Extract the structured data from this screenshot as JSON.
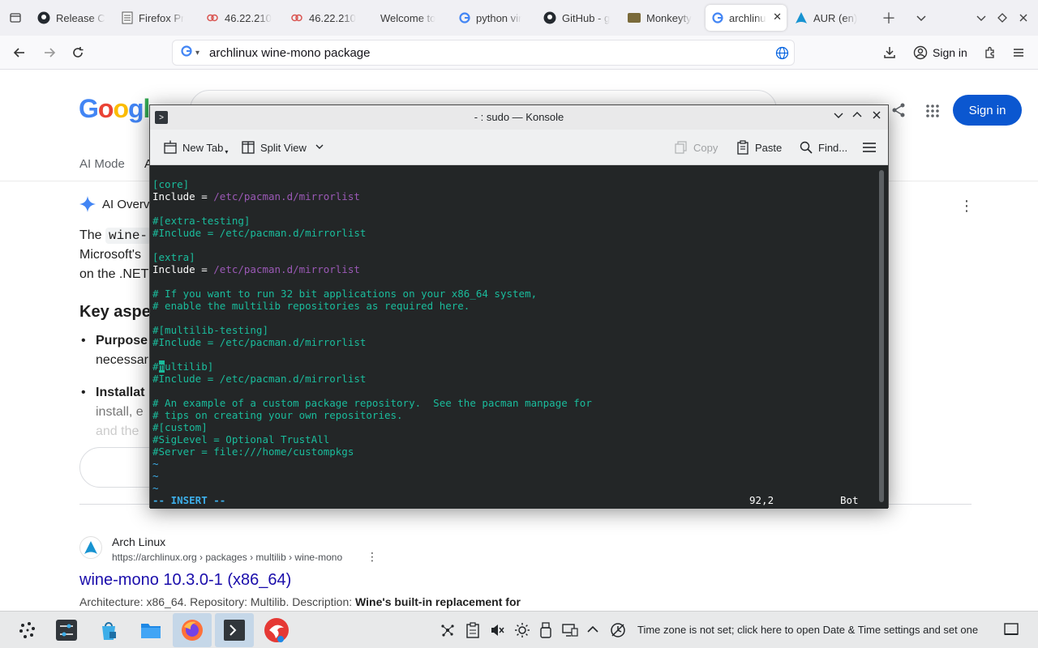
{
  "browser": {
    "tabs": [
      {
        "title": "Release C",
        "icon": "github-icon"
      },
      {
        "title": "Firefox Pr",
        "icon": "document-icon"
      },
      {
        "title": "46.22.210",
        "icon": "link-icon"
      },
      {
        "title": "46.22.210",
        "icon": "link-icon"
      },
      {
        "title": "Welcome to",
        "icon": "none"
      },
      {
        "title": "python vir",
        "icon": "google-icon"
      },
      {
        "title": "GitHub - g",
        "icon": "github-icon"
      },
      {
        "title": "Monkeyty",
        "icon": "monkeytype-icon"
      },
      {
        "title": "archlinu",
        "icon": "google-icon"
      },
      {
        "title": "AUR (en)",
        "icon": "arch-icon"
      }
    ],
    "url": "archlinux wine-mono package",
    "sign_in": "Sign in",
    "accent": "#0b57d0"
  },
  "google": {
    "logo": "Googl",
    "sign_in": "Sign in",
    "tab_ai_mode": "AI Mode",
    "tab_all": "A",
    "ai_overview": "AI Overv",
    "p1_a": "The ",
    "p1_code": "wine-",
    "p2": "Microsoft's",
    "p3": "on the .NET",
    "heading": "Key aspe",
    "b1": "Purpose",
    "b1_cont": "necessar",
    "b2": "Installat",
    "b2_cont": "install, e",
    "b2_cont2": "and the",
    "result": {
      "site": "Arch Linux",
      "url": "https://archlinux.org › packages › multilib › wine-mono",
      "title": "wine-mono 10.3.0-1 (x86_64)",
      "desc_a": "Architecture: x86_64. Repository: Multilib. Description: ",
      "desc_b": "Wine's built-in replacement for"
    }
  },
  "konsole": {
    "title": "- : sudo — Konsole",
    "new_tab": "New Tab",
    "split_view": "Split View",
    "copy": "Copy",
    "paste": "Paste",
    "find": "Find...",
    "lines": [
      {
        "segments": [
          {
            "t": "[core]",
            "c": "c-green"
          }
        ]
      },
      {
        "segments": [
          {
            "t": "Include = ",
            "c": "c-white"
          },
          {
            "t": "/etc/pacman.d/mirrorlist",
            "c": "c-purple"
          }
        ]
      },
      {
        "segments": [
          {
            "t": "",
            "c": "c-white"
          }
        ]
      },
      {
        "segments": [
          {
            "t": "#[extra-testing]",
            "c": "c-comment"
          }
        ]
      },
      {
        "segments": [
          {
            "t": "#Include = /etc/pacman.d/mirrorlist",
            "c": "c-comment"
          }
        ]
      },
      {
        "segments": [
          {
            "t": "",
            "c": "c-white"
          }
        ]
      },
      {
        "segments": [
          {
            "t": "[extra]",
            "c": "c-green"
          }
        ]
      },
      {
        "segments": [
          {
            "t": "Include = ",
            "c": "c-white"
          },
          {
            "t": "/etc/pacman.d/mirrorlist",
            "c": "c-purple"
          }
        ]
      },
      {
        "segments": [
          {
            "t": "",
            "c": "c-white"
          }
        ]
      },
      {
        "segments": [
          {
            "t": "# If you want to run 32 bit applications on your x86_64 system,",
            "c": "c-comment"
          }
        ]
      },
      {
        "segments": [
          {
            "t": "# enable the multilib repositories as required here.",
            "c": "c-comment"
          }
        ]
      },
      {
        "segments": [
          {
            "t": "",
            "c": "c-white"
          }
        ]
      },
      {
        "segments": [
          {
            "t": "#[multilib-testing]",
            "c": "c-comment"
          }
        ]
      },
      {
        "segments": [
          {
            "t": "#Include = /etc/pacman.d/mirrorlist",
            "c": "c-comment"
          }
        ]
      },
      {
        "segments": [
          {
            "t": "",
            "c": "c-white"
          }
        ]
      },
      {
        "segments": [
          {
            "t": "#",
            "c": "c-comment"
          },
          {
            "t": "m",
            "c": "cursor"
          },
          {
            "t": "ultilib]",
            "c": "c-comment"
          }
        ]
      },
      {
        "segments": [
          {
            "t": "#Include = /etc/pacman.d/mirrorlist",
            "c": "c-comment"
          }
        ]
      },
      {
        "segments": [
          {
            "t": "",
            "c": "c-white"
          }
        ]
      },
      {
        "segments": [
          {
            "t": "# An example of a custom package repository.  See the pacman manpage for",
            "c": "c-comment"
          }
        ]
      },
      {
        "segments": [
          {
            "t": "# tips on creating your own repositories.",
            "c": "c-comment"
          }
        ]
      },
      {
        "segments": [
          {
            "t": "#[custom]",
            "c": "c-comment"
          }
        ]
      },
      {
        "segments": [
          {
            "t": "#SigLevel = Optional TrustAll",
            "c": "c-comment"
          }
        ]
      },
      {
        "segments": [
          {
            "t": "#Server = file:///home/custompkgs",
            "c": "c-comment"
          }
        ]
      },
      {
        "segments": [
          {
            "t": "~",
            "c": "c-tilde"
          }
        ]
      },
      {
        "segments": [
          {
            "t": "~",
            "c": "c-tilde"
          }
        ]
      },
      {
        "segments": [
          {
            "t": "~",
            "c": "c-tilde"
          }
        ]
      }
    ],
    "mode": "-- INSERT --",
    "position": "92,2",
    "scroll": "Bot"
  },
  "taskbar": {
    "tray_message": "Time zone is not set; click here to open Date & Time settings and set one"
  }
}
